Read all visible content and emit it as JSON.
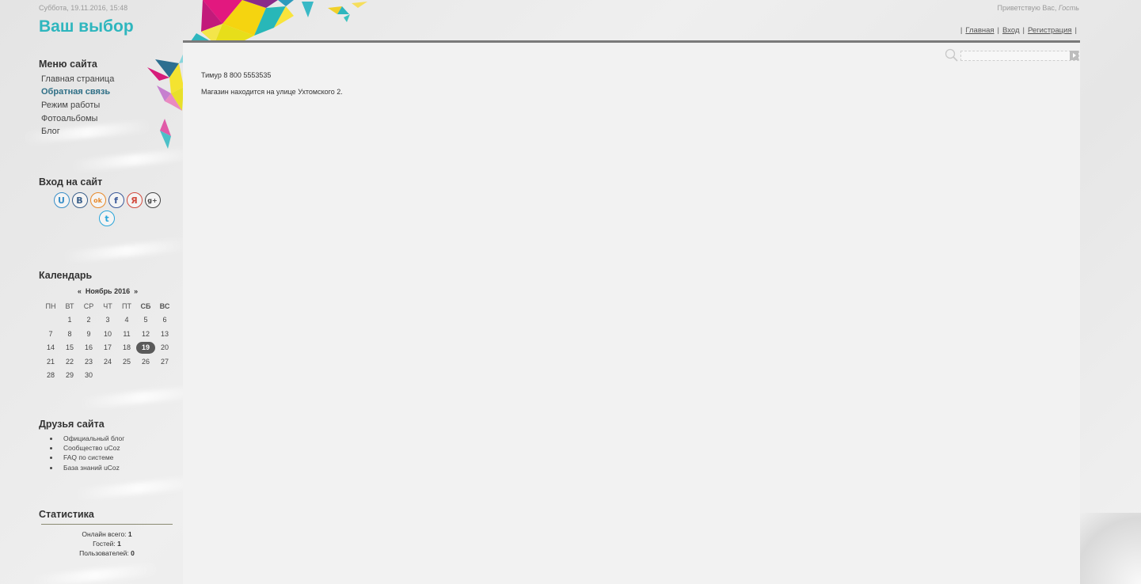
{
  "header": {
    "date": "Суббота, 19.11.2016, 15:48",
    "title": "Ваш выбор",
    "greeting_prefix": "Приветствую Вас,",
    "greeting_name": "Гость",
    "nav": [
      "Главная",
      "Вход",
      "Регистрация"
    ]
  },
  "search": {
    "placeholder": ""
  },
  "content": {
    "lines": [
      "Тимур 8 800 5553535",
      "Магазин находится на улице Ухтомского 2."
    ]
  },
  "sidebar": {
    "menu": {
      "title": "Меню сайта",
      "items": [
        {
          "label": "Главная страница"
        },
        {
          "label": "Обратная связь"
        },
        {
          "label": "Режим работы"
        },
        {
          "label": "Фотоальбомы"
        },
        {
          "label": "Блог"
        }
      ]
    },
    "login": {
      "title": "Вход на сайт",
      "providers": [
        {
          "name": "ucoz-icon",
          "glyph": "U",
          "color": "#3a8fc8"
        },
        {
          "name": "vkontakte-icon",
          "glyph": "В",
          "color": "#3a5f8a"
        },
        {
          "name": "odnoklassniki-icon",
          "glyph": "ok",
          "color": "#e8892a"
        },
        {
          "name": "facebook-icon",
          "glyph": "f",
          "color": "#3b5998"
        },
        {
          "name": "yandex-icon",
          "glyph": "Я",
          "color": "#d24b3e"
        },
        {
          "name": "google-plus-icon",
          "glyph": "g+",
          "color": "#444444"
        },
        {
          "name": "twitter-icon",
          "glyph": "t",
          "color": "#2aa5d9"
        }
      ]
    },
    "calendar": {
      "title": "Календарь",
      "prev": "«",
      "month": "Ноябрь 2016",
      "next": "»",
      "weekdays": [
        "ПН",
        "ВТ",
        "СР",
        "ЧТ",
        "ПТ",
        "СБ",
        "ВС"
      ],
      "first_weekday_offset": 1,
      "days": 30,
      "today": 19
    },
    "friends": {
      "title": "Друзья сайта",
      "items": [
        "Официальный блог",
        "Сообщество uCoz",
        "FAQ по системе",
        "База знаний uCoz"
      ]
    },
    "stats": {
      "title": "Статистика",
      "online_label": "Онлайн всего:",
      "online": "1",
      "guests_label": "Гостей:",
      "guests": "1",
      "users_label": "Пользователей:",
      "users": "0"
    }
  },
  "colors": {
    "accent": "#2eb6be",
    "active_menu": "#2f6f86",
    "today_bg": "#5a5a5a"
  }
}
